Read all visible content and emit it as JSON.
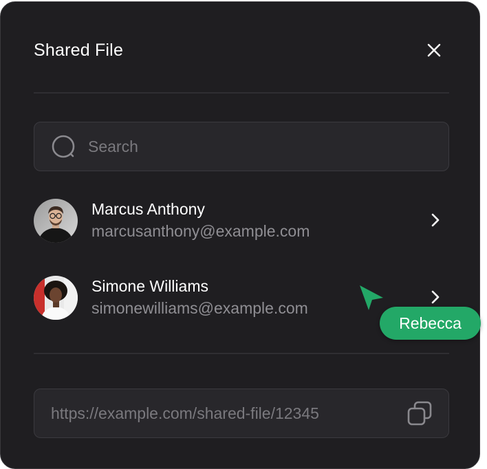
{
  "dialog": {
    "title": "Shared File"
  },
  "search": {
    "placeholder": "Search",
    "value": ""
  },
  "people": [
    {
      "name": "Marcus Anthony",
      "email": "marcusanthony@example.com",
      "avatar_icon": "avatar-marcus"
    },
    {
      "name": "Simone Williams",
      "email": "simonewilliams@example.com",
      "avatar_icon": "avatar-simone"
    }
  ],
  "cursor": {
    "user_label": "Rebecca",
    "color": "#23a867"
  },
  "share_link": {
    "url": "https://example.com/shared-file/12345"
  },
  "icons": {
    "close": "close-icon",
    "search": "search-icon",
    "chevron": "chevron-right-icon",
    "copy": "copy-icon"
  },
  "colors": {
    "background": "#1f1e21",
    "field": "#28272b",
    "accent": "#23a867",
    "text_primary": "#ffffff",
    "text_secondary": "#8f8e93"
  }
}
